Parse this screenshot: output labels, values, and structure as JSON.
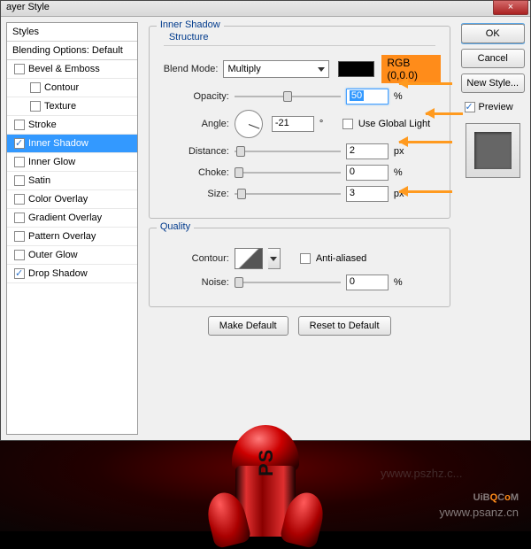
{
  "title": "ayer Style",
  "left": {
    "styles": "Styles",
    "blending": "Blending Options: Default",
    "items": [
      {
        "label": "Bevel & Emboss",
        "checked": false,
        "indent": false
      },
      {
        "label": "Contour",
        "checked": false,
        "indent": true,
        "nocheck": false
      },
      {
        "label": "Texture",
        "checked": false,
        "indent": true,
        "nocheck": false
      },
      {
        "label": "Stroke",
        "checked": false
      },
      {
        "label": "Inner Shadow",
        "checked": true,
        "selected": true
      },
      {
        "label": "Inner Glow",
        "checked": false
      },
      {
        "label": "Satin",
        "checked": false
      },
      {
        "label": "Color Overlay",
        "checked": false
      },
      {
        "label": "Gradient Overlay",
        "checked": false
      },
      {
        "label": "Pattern Overlay",
        "checked": false
      },
      {
        "label": "Outer Glow",
        "checked": false
      },
      {
        "label": "Drop Shadow",
        "checked": true
      }
    ]
  },
  "panel": {
    "heading": "Inner Shadow",
    "structure": "Structure",
    "blendmode_lbl": "Blend Mode:",
    "blendmode_val": "Multiply",
    "rgb": "RGB (0,0,0)",
    "opacity_lbl": "Opacity:",
    "opacity_val": "50",
    "angle_lbl": "Angle:",
    "angle_val": "-21",
    "ugl": "Use Global Light",
    "distance_lbl": "Distance:",
    "distance_val": "2",
    "choke_lbl": "Choke:",
    "choke_val": "0",
    "size_lbl": "Size:",
    "size_val": "3",
    "pct": "%",
    "px": "px",
    "deg": "°",
    "quality": "Quality",
    "contour_lbl": "Contour:",
    "aa": "Anti-aliased",
    "noise_lbl": "Noise:",
    "noise_val": "0",
    "make_default": "Make Default",
    "reset_default": "Reset to Default"
  },
  "right": {
    "ok": "OK",
    "cancel": "Cancel",
    "newstyle": "New Style...",
    "preview": "Preview"
  },
  "water": {
    "brand_a": "UiB",
    "brand_b": "Q",
    ".": ".",
    "brand_c": "C",
    "brand_d": "o",
    "brand_e": "M",
    "url": "ywww.psanz.cn",
    "url2": "ywww.pszhz.c..."
  }
}
